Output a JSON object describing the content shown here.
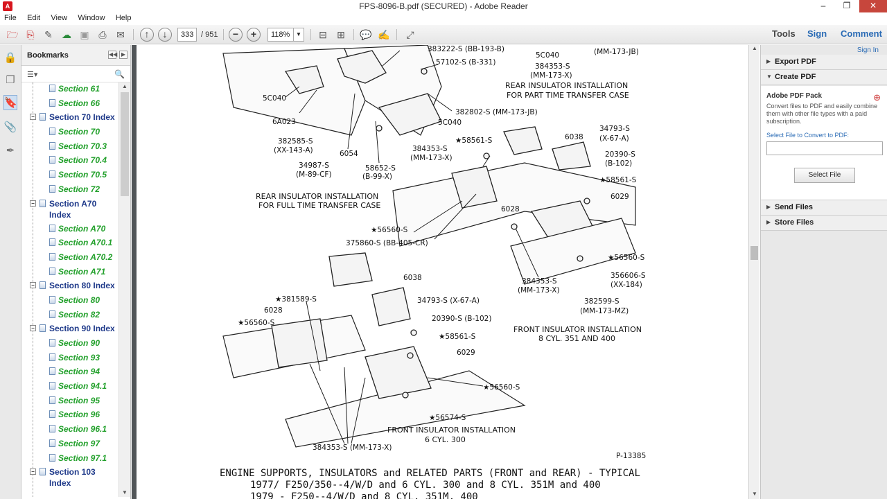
{
  "window": {
    "title": "FPS-8096-B.pdf (SECURED) - Adobe Reader",
    "app_icon_glyph": "A",
    "controls": [
      "–",
      "❐",
      "✕"
    ]
  },
  "menu": [
    "File",
    "Edit",
    "View",
    "Window",
    "Help"
  ],
  "toolbar": {
    "page_current": "333",
    "page_total": "/ 951",
    "zoom": "118%",
    "tools_label": "Tools",
    "sign_label": "Sign",
    "comment_label": "Comment"
  },
  "bookmarks": {
    "header": "Bookmarks",
    "items": [
      {
        "label": "Section 61",
        "level": 2
      },
      {
        "label": "Section 66",
        "level": 2
      },
      {
        "label": "Section 70 Index",
        "level": 1
      },
      {
        "label": "Section 70",
        "level": 2
      },
      {
        "label": "Section 70.3",
        "level": 2
      },
      {
        "label": "Section 70.4",
        "level": 2
      },
      {
        "label": "Section 70.5",
        "level": 2
      },
      {
        "label": "Section 72",
        "level": 2
      },
      {
        "label": "Section A70 Index",
        "level": 1,
        "wrap": true
      },
      {
        "label": "Section A70",
        "level": 2
      },
      {
        "label": "Section A70.1",
        "level": 2
      },
      {
        "label": "Section A70.2",
        "level": 2
      },
      {
        "label": "Section A71",
        "level": 2
      },
      {
        "label": "Section 80 Index",
        "level": 1
      },
      {
        "label": "Section 80",
        "level": 2
      },
      {
        "label": "Section 82",
        "level": 2
      },
      {
        "label": "Section 90 Index",
        "level": 1
      },
      {
        "label": "Section 90",
        "level": 2
      },
      {
        "label": "Section 93",
        "level": 2
      },
      {
        "label": "Section 94",
        "level": 2
      },
      {
        "label": "Section 94.1",
        "level": 2
      },
      {
        "label": "Section 95",
        "level": 2
      },
      {
        "label": "Section 96",
        "level": 2
      },
      {
        "label": "Section 96.1",
        "level": 2
      },
      {
        "label": "Section 97",
        "level": 2
      },
      {
        "label": "Section 97.1",
        "level": 2
      },
      {
        "label": "Section 103 Index",
        "level": 1,
        "wrap": true
      }
    ]
  },
  "right_panel": {
    "signin": "Sign In",
    "export_pdf": "Export PDF",
    "create_pdf": "Create PDF",
    "pack_title": "Adobe PDF Pack",
    "pack_desc": "Convert files to PDF and easily combine them with other file types with a paid subscription.",
    "select_label": "Select File to Convert to PDF:",
    "select_button": "Select File",
    "send_files": "Send Files",
    "store_files": "Store Files"
  },
  "document": {
    "labels": {
      "l1": "383222-S (BB-193-B)",
      "l2": "5C040",
      "l3": "(MM-173-JB)",
      "l4": "384353-S",
      "l5": "(MM-173-X)",
      "l6": "57102-S (B-331)",
      "l7": "REAR INSULATOR INSTALLATION",
      "l8": "FOR PART TIME TRANSFER CASE",
      "l9": "5C040",
      "l10": "382802-S (MM-173-JB)",
      "l11": "6A023",
      "l12": "5C040",
      "l13": "382585-S",
      "l14": "(XX-143-A)",
      "l15": "6054",
      "l16": "384353-S",
      "l17": "(MM-173-X)",
      "l18": "★58561-S",
      "l19": "6038",
      "l20": "34793-S",
      "l21": "(X-67-A)",
      "l22": "20390-S",
      "l23": "(B-102)",
      "l24": "34987-S",
      "l25": "(M-89-CF)",
      "l26": "58652-S",
      "l27": "(B-99-X)",
      "l28": "★58561-S",
      "l29": "6029",
      "l30": "REAR INSULATOR INSTALLATION",
      "l31": "FOR FULL TIME TRANSFER CASE",
      "l32": "6028",
      "l33": "★56560-S",
      "l34": "375860-S (BB-405-CR)",
      "l35": "★56560-S",
      "l36": "356606-S",
      "l37": "(XX-184)",
      "l38": "6038",
      "l39": "384353-S",
      "l40": "(MM-173-X)",
      "l41": "382599-S",
      "l42": "(MM-173-MZ)",
      "l43": "★381589-S",
      "l44": "34793-S (X-67-A)",
      "l45": "6028",
      "l46": "★56560-S",
      "l47": "20390-S (B-102)",
      "l48": "FRONT INSULATOR INSTALLATION",
      "l49": "8 CYL. 351 AND 400",
      "l50": "★58561-S",
      "l51": "6029",
      "l52": "★56560-S",
      "l53": "★56574-S",
      "l54": "FRONT INSULATOR INSTALLATION",
      "l55": "6 CYL. 300",
      "l56": "384353-S (MM-173-X)",
      "l57": "P-13385"
    },
    "caption_line1": "ENGINE SUPPORTS, INSULATORS and RELATED PARTS (FRONT and REAR) - TYPICAL",
    "caption_line2": "1977/   F250/350--4/W/D and 6 CYL. 300 and 8 CYL. 351M and 400",
    "caption_line3": "1979 -  F250--4/W/D and 8 CYL. 351M, 400"
  }
}
